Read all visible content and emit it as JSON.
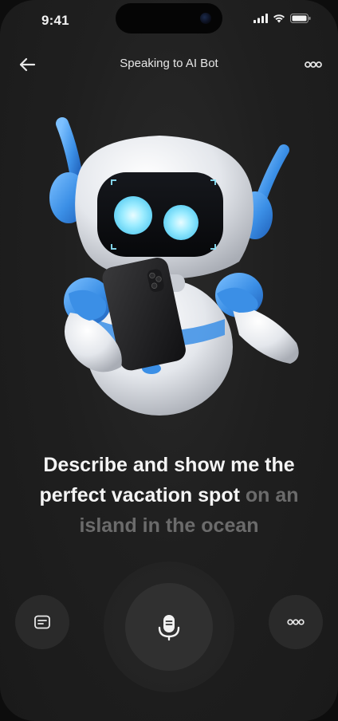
{
  "status_bar": {
    "time": "9:41"
  },
  "header": {
    "title": "Speaking to AI Bot"
  },
  "prompt": {
    "spoken": "Describe and show me the perfect vacation spot",
    "pending": " on an island in the ocean"
  },
  "icons": {
    "back": "arrow-left-icon",
    "menu": "more-horizontal-icon",
    "keyboard": "keyboard-icon",
    "mic": "microphone-icon",
    "more": "more-horizontal-icon"
  },
  "colors": {
    "background": "#1f1f1f",
    "accent_blue": "#3b8fe6",
    "eye_glow": "#8fe9ff",
    "text_primary": "#f4f4f4",
    "text_pending": "#6b6b6b"
  }
}
